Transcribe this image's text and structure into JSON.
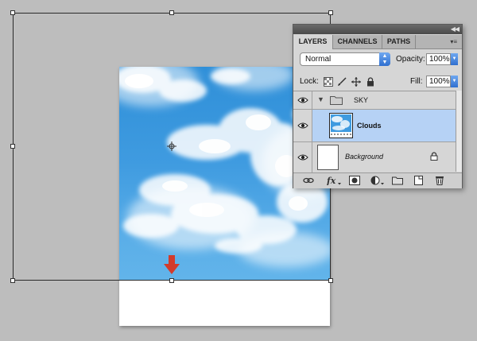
{
  "layers_panel": {
    "tabs": [
      {
        "label": "LAYERS",
        "active": true
      },
      {
        "label": "CHANNELS",
        "active": false
      },
      {
        "label": "PATHS",
        "active": false
      }
    ],
    "blend_mode": "Normal",
    "opacity_label": "Opacity:",
    "opacity_value": "100%",
    "lock_label": "Lock:",
    "fill_label": "Fill:",
    "fill_value": "100%",
    "layers": [
      {
        "name": "SKY",
        "type": "group",
        "expanded": true,
        "visible": true
      },
      {
        "name": "Clouds",
        "type": "layer",
        "selected": true,
        "visible": true
      },
      {
        "name": "Background",
        "type": "background",
        "locked": true,
        "visible": true
      }
    ],
    "footer_icons": [
      "link-icon",
      "fx-icon",
      "mask-icon",
      "adjustment-icon",
      "group-icon",
      "new-layer-icon",
      "trash-icon"
    ]
  },
  "colors": {
    "canvas_bg": "#bdbdbd",
    "sky_top": "#2f8fd8",
    "sky_bottom": "#62b4ea",
    "selected_row": "#b6d2f5",
    "arrow": "#d23b2c"
  }
}
